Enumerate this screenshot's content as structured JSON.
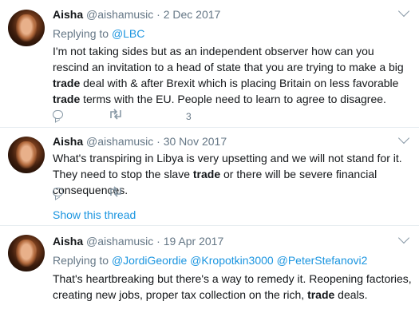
{
  "tweets": [
    {
      "name": "Aisha",
      "handle": "@aishamusic",
      "date": "2 Dec 2017",
      "replying_prefix": "Replying to",
      "replying_to": [
        "@LBC"
      ],
      "text_parts": [
        "I'm not taking sides but as an independent observer how can you rescind an invitation to a head of state that you are trying to make a big ",
        "trade",
        " deal with & after Brexit which is placing Britain on less favorable ",
        "trade",
        " terms with the EU. People need to learn to agree to disagree."
      ],
      "like_count": "3"
    },
    {
      "name": "Aisha",
      "handle": "@aishamusic",
      "date": "30 Nov 2017",
      "text_parts": [
        "What's transpiring in Libya is very upsetting and we will not stand for it. They need to stop the slave ",
        "trade",
        " or there will be severe financial consequences."
      ],
      "show_thread": "Show this thread"
    },
    {
      "name": "Aisha",
      "handle": "@aishamusic",
      "date": "19 Apr 2017",
      "replying_prefix": "Replying to",
      "replying_to": [
        "@JordiGeordie",
        "@Kropotkin3000",
        "@PeterStefanovi2"
      ],
      "text_parts": [
        "That's heartbreaking but there's a way to remedy it. Reopening factories, creating new jobs, proper tax collection on the rich, ",
        "trade",
        " deals."
      ]
    }
  ],
  "meta_separator": " · ",
  "icons": {
    "reply": "reply-icon",
    "retweet": "retweet-icon",
    "caret": "chevron-down-icon",
    "avatar": "avatar"
  },
  "colors": {
    "link": "#1b95e0",
    "muted": "#657786",
    "text": "#14171a",
    "divider": "#e6ecf0"
  }
}
